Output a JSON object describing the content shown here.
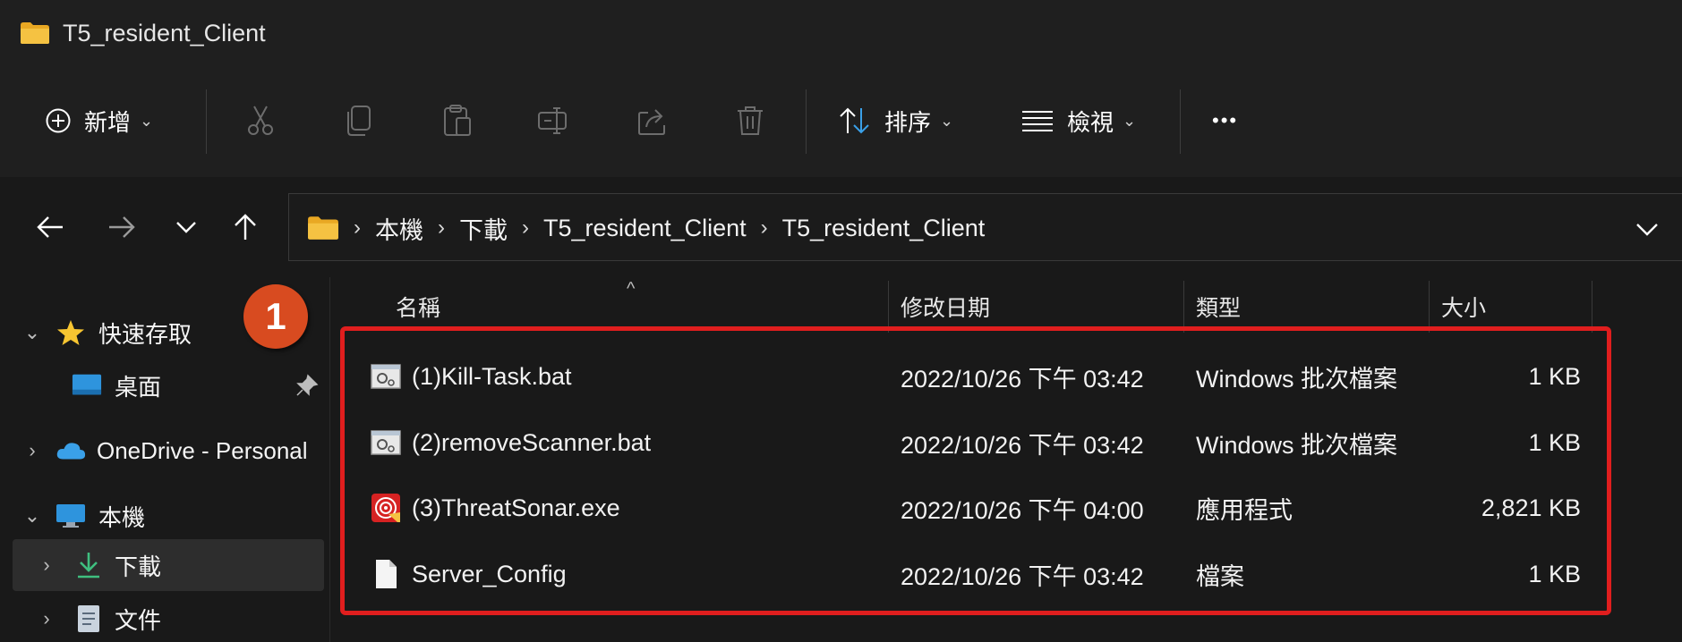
{
  "window": {
    "title": "T5_resident_Client"
  },
  "toolbar": {
    "new_label": "新增",
    "sort_label": "排序",
    "view_label": "檢視",
    "more_label": "•••"
  },
  "address": {
    "crumbs": [
      "本機",
      "下載",
      "T5_resident_Client",
      "T5_resident_Client"
    ]
  },
  "nav": {
    "items": [
      {
        "label": "快速存取"
      },
      {
        "label": "桌面"
      },
      {
        "label": "OneDrive - Personal"
      },
      {
        "label": "本機"
      },
      {
        "label": "下載"
      },
      {
        "label": "文件"
      }
    ]
  },
  "columns": {
    "name": "名稱",
    "modified": "修改日期",
    "type": "類型",
    "size": "大小"
  },
  "files": [
    {
      "name": "(1)Kill-Task.bat",
      "modified": "2022/10/26 下午 03:42",
      "type": "Windows 批次檔案",
      "size": "1 KB",
      "icon": "batch-file-icon"
    },
    {
      "name": "(2)removeScanner.bat",
      "modified": "2022/10/26 下午 03:42",
      "type": "Windows 批次檔案",
      "size": "1 KB",
      "icon": "batch-file-icon"
    },
    {
      "name": "(3)ThreatSonar.exe",
      "modified": "2022/10/26 下午 04:00",
      "type": "應用程式",
      "size": "2,821 KB",
      "icon": "threatsonar-app-icon"
    },
    {
      "name": "Server_Config",
      "modified": "2022/10/26 下午 03:42",
      "type": "檔案",
      "size": "1 KB",
      "icon": "generic-file-icon"
    }
  ],
  "annotation": {
    "step": "1",
    "color": "#d84b20",
    "box_color": "#e01e1e"
  },
  "colors": {
    "background": "#191919",
    "toolbar": "#1f1f1f",
    "selected": "#2d2d2d",
    "folder": "#f5c242",
    "download_arrow": "#3fbf7f",
    "accent_blue": "#3aa0e8"
  }
}
